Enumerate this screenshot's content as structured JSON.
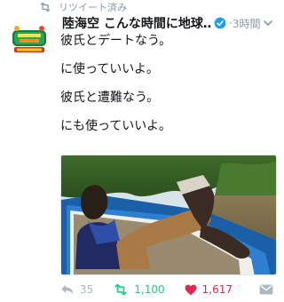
{
  "retweet_context": {
    "label": "リツイート済み",
    "icon": "retweet-icon"
  },
  "tweet": {
    "author_name": "陸海空 こんな時間に地球…",
    "verified": true,
    "separator": "·",
    "time": "3時間",
    "lines": [
      "彼氏とデートなう。",
      "に使っていいよ。",
      "彼氏と遭難なう。",
      "にも使っていいよ。"
    ],
    "media": {
      "type": "photo"
    }
  },
  "actions": {
    "reply_count": "35",
    "retweet_count": "1,100",
    "like_count": "1,617"
  },
  "colors": {
    "retweet_active": "#19cf86",
    "like_active": "#e2264d",
    "muted": "#8899a6",
    "verified_blue": "#1da1f2"
  }
}
